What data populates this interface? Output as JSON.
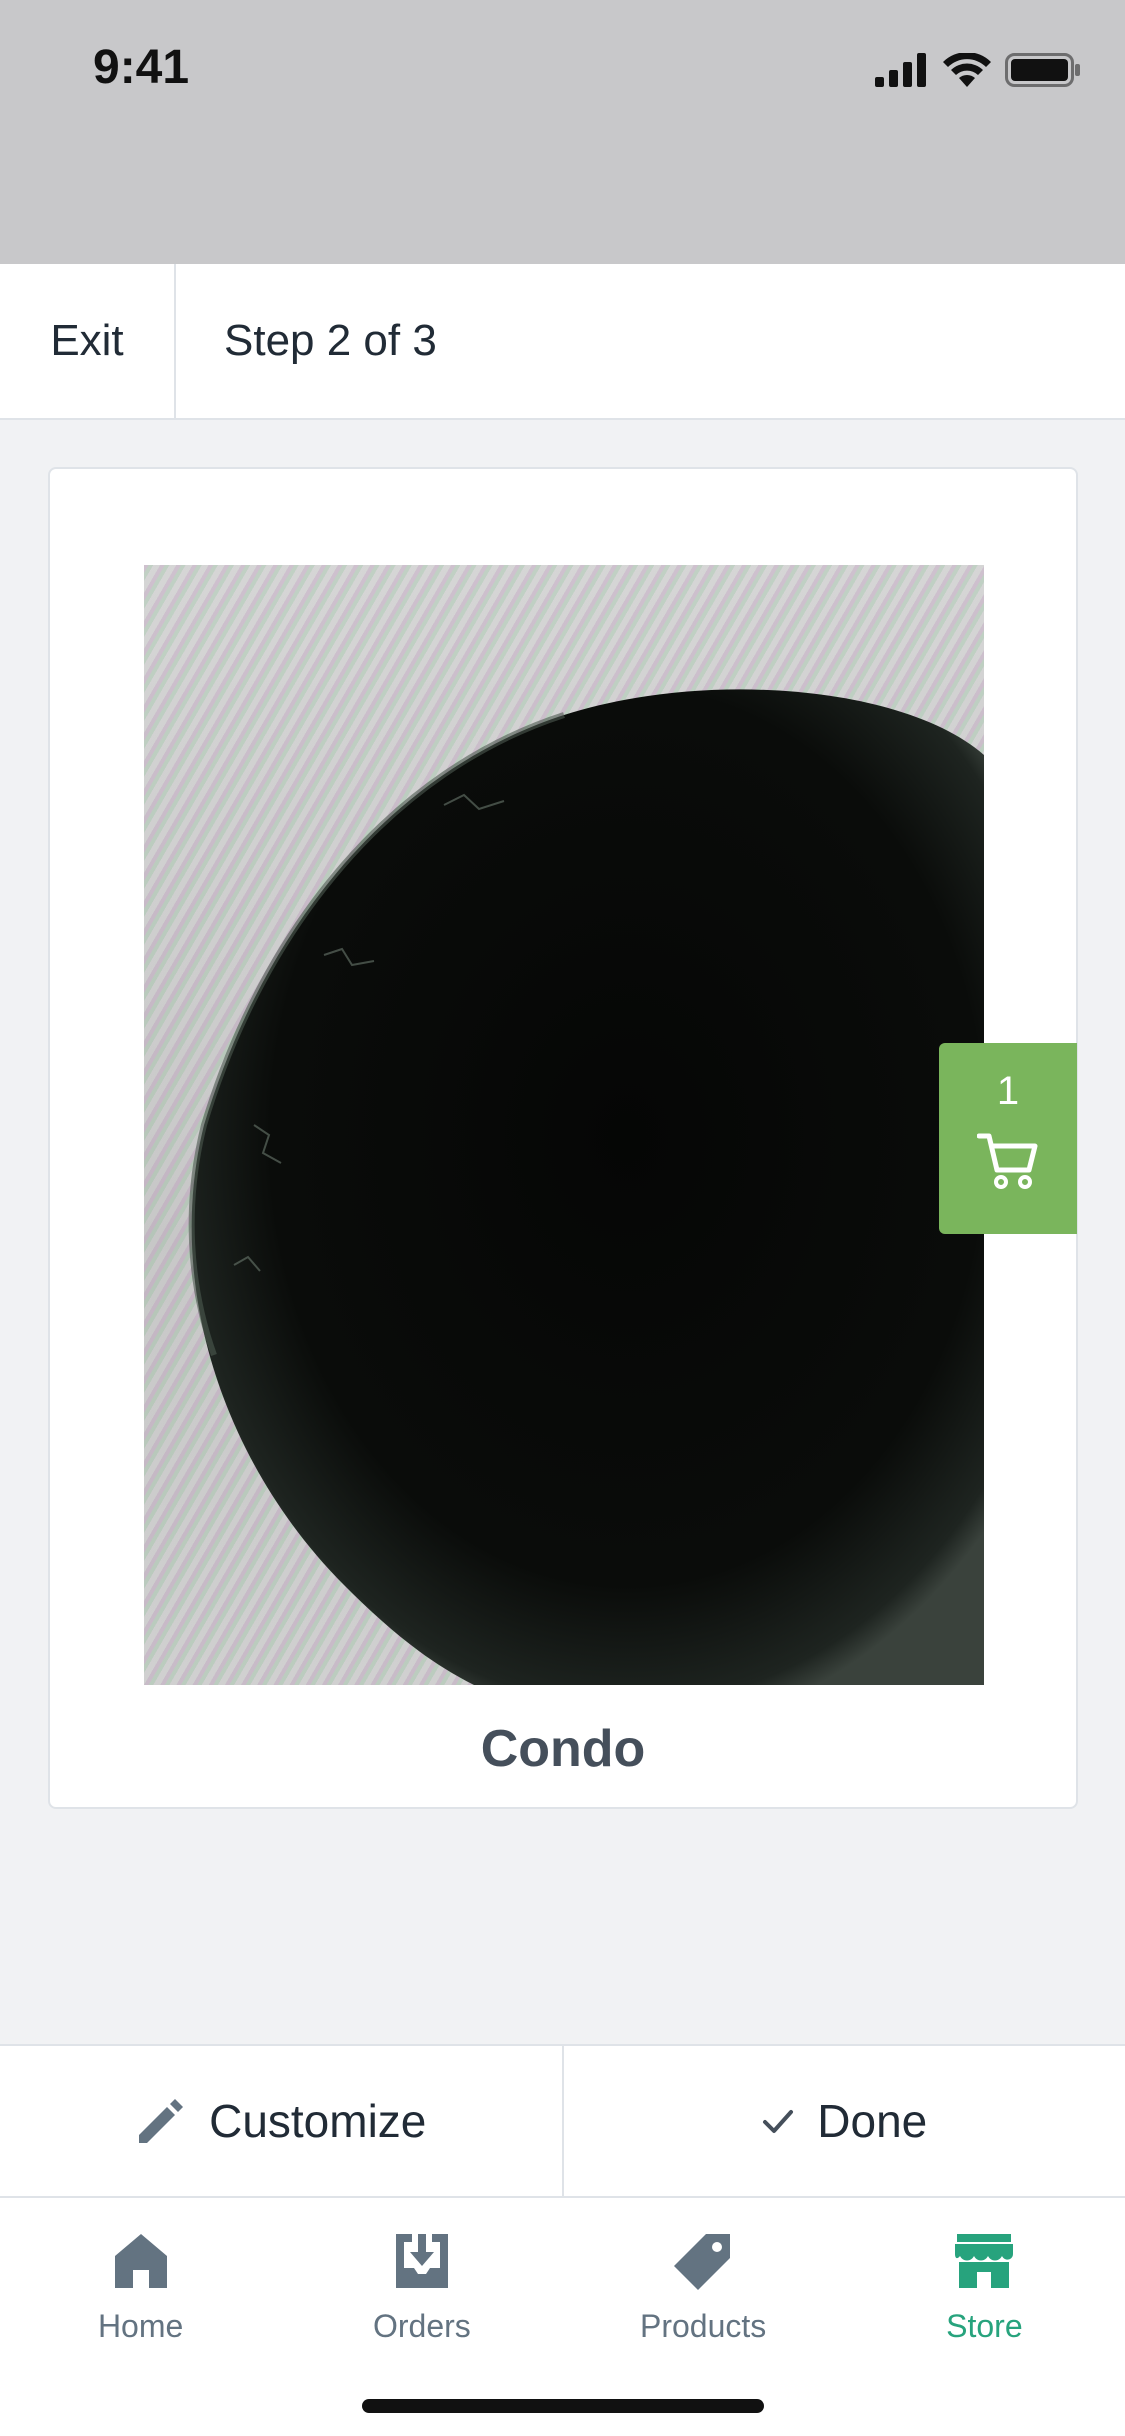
{
  "status_bar": {
    "time": "9:41"
  },
  "top_bar": {
    "exit_label": "Exit",
    "step_label": "Step 2 of 3"
  },
  "product": {
    "title": "Condo"
  },
  "cart": {
    "count": "1"
  },
  "actions": {
    "customize_label": "Customize",
    "done_label": "Done"
  },
  "tabs": [
    {
      "label": "Home",
      "icon": "home-icon"
    },
    {
      "label": "Orders",
      "icon": "orders-icon"
    },
    {
      "label": "Products",
      "icon": "tag-icon"
    },
    {
      "label": "Store",
      "icon": "store-icon",
      "active": true
    }
  ],
  "colors": {
    "accent": "#27a37d",
    "cart": "#7ab55c",
    "inactive": "#637381"
  }
}
